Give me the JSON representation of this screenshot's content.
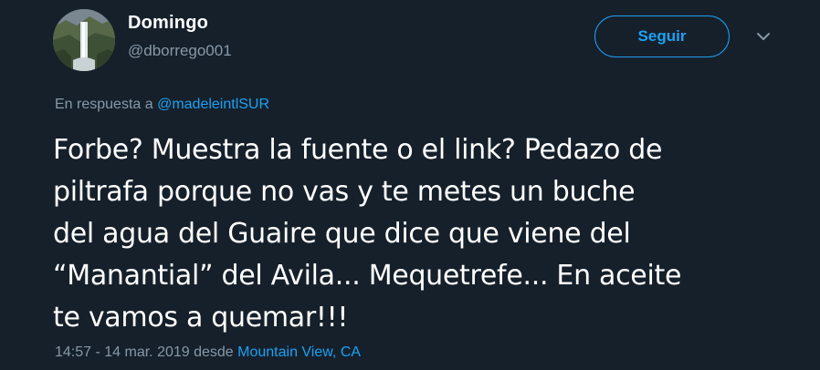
{
  "author": {
    "display_name": "Domingo",
    "handle": "@dborrego001"
  },
  "follow_button": {
    "label": "Seguir"
  },
  "reply": {
    "prefix": "En respuesta a",
    "mention": "@madeleintlSUR"
  },
  "tweet": {
    "lines": [
      "Forbe? Muestra la fuente o el link? Pedazo de",
      "piltrafa porque no vas y te metes un buche",
      "del agua del Guaire que dice que viene del",
      "“Manantial” del Avila... Mequetrefe... En aceite",
      "te vamos a quemar!!!"
    ]
  },
  "meta": {
    "timestamp": "14:57 - 14 mar. 2019",
    "from_label": "desde",
    "location": "Mountain View, CA"
  },
  "icons": {
    "avatar": "waterfall-photo-avatar",
    "menu": "chevron-down-icon"
  },
  "colors": {
    "background": "#15202b",
    "accent": "#1da1f2",
    "secondary_text": "#8899a6",
    "primary_text": "#ffffff"
  }
}
